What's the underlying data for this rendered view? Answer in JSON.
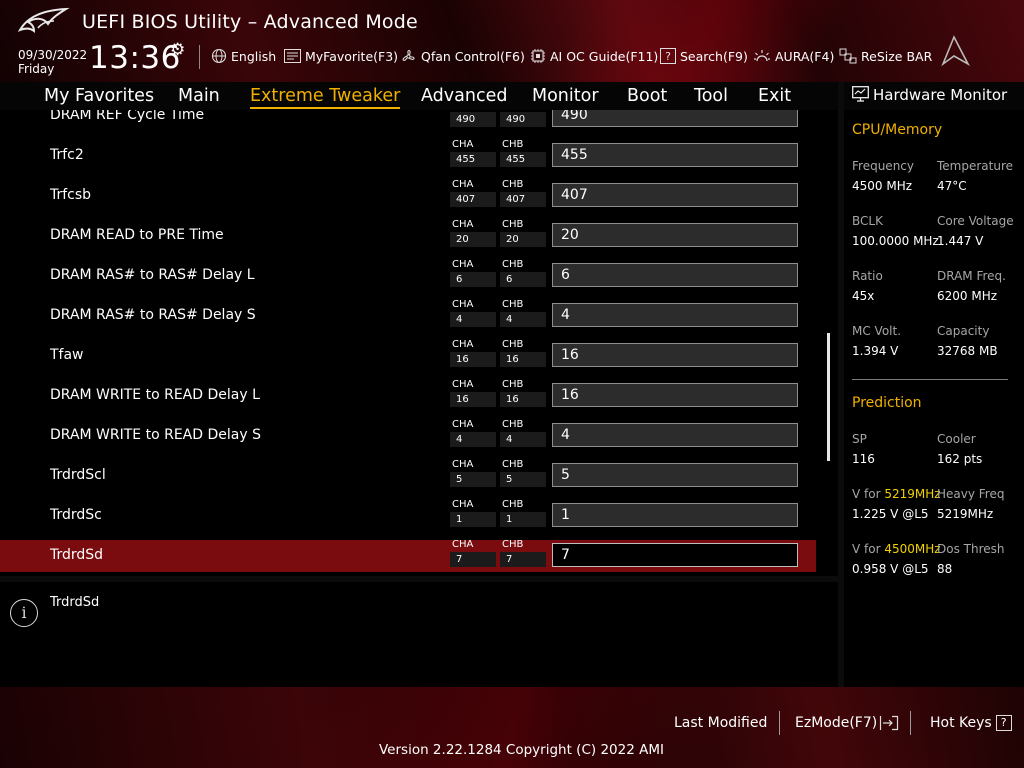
{
  "header": {
    "title": "UEFI BIOS Utility – Advanced Mode",
    "date": "09/30/2022",
    "weekday": "Friday",
    "time": "13:36",
    "toolbar": [
      {
        "id": "language",
        "icon": "globe-icon",
        "label": "English"
      },
      {
        "id": "myfavorite",
        "icon": "favorite-list-icon",
        "label": "MyFavorite(F3)"
      },
      {
        "id": "qfan",
        "icon": "fan-icon",
        "label": "Qfan Control(F6)"
      },
      {
        "id": "aioc",
        "icon": "chip-icon",
        "label": "AI OC Guide(F11)"
      },
      {
        "id": "search",
        "icon": "question-box-icon",
        "label": "Search(F9)"
      },
      {
        "id": "aura",
        "icon": "aura-light-icon",
        "label": "AURA(F4)"
      },
      {
        "id": "resizebar",
        "icon": "resize-bar-icon",
        "label": "ReSize BAR"
      }
    ]
  },
  "nav": {
    "tabs": [
      "My Favorites",
      "Main",
      "Extreme Tweaker",
      "Advanced",
      "Monitor",
      "Boot",
      "Tool",
      "Exit"
    ],
    "active": "Extreme Tweaker"
  },
  "settings": {
    "channel_labels": [
      "CHA",
      "CHB"
    ],
    "rows": [
      {
        "label": "DRAM REF Cycle Time",
        "cha": "490",
        "chb": "490",
        "value": "490"
      },
      {
        "label": "Trfc2",
        "cha": "455",
        "chb": "455",
        "value": "455"
      },
      {
        "label": "Trfcsb",
        "cha": "407",
        "chb": "407",
        "value": "407"
      },
      {
        "label": "DRAM READ to PRE Time",
        "cha": "20",
        "chb": "20",
        "value": "20"
      },
      {
        "label": "DRAM RAS# to RAS# Delay L",
        "cha": "6",
        "chb": "6",
        "value": "6"
      },
      {
        "label": "DRAM RAS# to RAS# Delay S",
        "cha": "4",
        "chb": "4",
        "value": "4"
      },
      {
        "label": "Tfaw",
        "cha": "16",
        "chb": "16",
        "value": "16"
      },
      {
        "label": "DRAM WRITE to READ Delay L",
        "cha": "16",
        "chb": "16",
        "value": "16"
      },
      {
        "label": "DRAM WRITE to READ Delay S",
        "cha": "4",
        "chb": "4",
        "value": "4"
      },
      {
        "label": "TrdrdScl",
        "cha": "5",
        "chb": "5",
        "value": "5"
      },
      {
        "label": "TrdrdSc",
        "cha": "1",
        "chb": "1",
        "value": "1"
      },
      {
        "label": "TrdrdSd",
        "cha": "7",
        "chb": "7",
        "value": "7"
      }
    ],
    "selected_index": 11
  },
  "help": {
    "text": "TrdrdSd"
  },
  "hardware_monitor": {
    "title": "Hardware Monitor",
    "cpu_memory": {
      "heading": "CPU/Memory",
      "items": [
        {
          "label": "Frequency",
          "value": "4500 MHz"
        },
        {
          "label": "Temperature",
          "value": "47°C"
        },
        {
          "label": "BCLK",
          "value": "100.0000 MHz"
        },
        {
          "label": "Core Voltage",
          "value": "1.447 V"
        },
        {
          "label": "Ratio",
          "value": "45x"
        },
        {
          "label": "DRAM Freq.",
          "value": "6200 MHz"
        },
        {
          "label": "MC Volt.",
          "value": "1.394 V"
        },
        {
          "label": "Capacity",
          "value": "32768 MB"
        }
      ]
    },
    "prediction": {
      "heading": "Prediction",
      "sp_label": "SP",
      "sp_value": "116",
      "cooler_label": "Cooler",
      "cooler_value": "162 pts",
      "v_for_prefix": "V for ",
      "v1_freq": "5219MHz",
      "v1_value": "1.225 V @L5",
      "heavy_freq_label": "Heavy Freq",
      "heavy_freq_value": "5219MHz",
      "v2_freq": "4500MHz",
      "v2_value": "0.958 V @L5",
      "dos_thresh_label": "Dos Thresh",
      "dos_thresh_value": "88"
    }
  },
  "footer": {
    "last_modified": "Last Modified",
    "ezmode": "EzMode(F7)",
    "hotkeys": "Hot Keys",
    "hotkeys_key": "?",
    "version": "Version 2.22.1284 Copyright (C) 2022 AMI"
  },
  "colors": {
    "accent": "#f0b000",
    "selected_row": "#7a0b0f",
    "header_red": "#5a0a10"
  }
}
